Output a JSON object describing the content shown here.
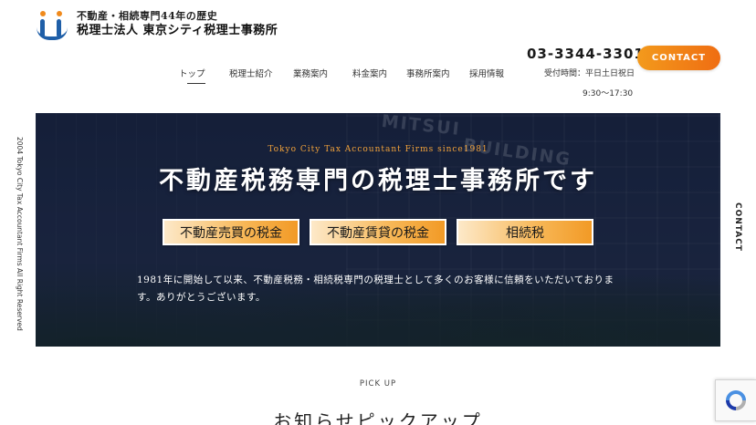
{
  "header": {
    "logo_line1": "不動産・相続専門44年の歴史",
    "logo_line2": "税理士法人 東京シティ税理士事務所",
    "phone": "03-3344-3301",
    "hours_label": "受付時間：平日土日祝日",
    "hours_time": "9:30〜17:30",
    "contact_label": "CONTACT"
  },
  "nav": {
    "items": [
      {
        "label": "トップ"
      },
      {
        "label": "税理士紹介"
      },
      {
        "label": "業務案内"
      },
      {
        "label": "料金案内"
      },
      {
        "label": "事務所案内"
      },
      {
        "label": "採用情報"
      }
    ],
    "active_index": 0
  },
  "side": {
    "copyright": "2004 Tokyo City Tax Accountant Firms All Right Reserved",
    "contact_vertical": "CONTACT"
  },
  "hero": {
    "subtitle": "Tokyo City Tax Accountant Firms since1981",
    "title": "不動産税務専門の税理士事務所です",
    "buttons": [
      {
        "label": "不動産売買の税金"
      },
      {
        "label": "不動産賃貸の税金"
      },
      {
        "label": "相続税"
      }
    ],
    "description": "1981年に開始して以来、不動産税務・相続税専門の税理士として多くのお客様に信頼をいただいております。ありがとうございます。",
    "building_sign_1": "MITSUI",
    "building_sign_2": "BUILDING"
  },
  "pickup": {
    "label": "PICK UP",
    "title": "お知らせピックアップ"
  },
  "colors": {
    "accent_orange": "#ef7a15",
    "logo_blue": "#1f5fa8",
    "hero_navy": "#1f2b47"
  }
}
